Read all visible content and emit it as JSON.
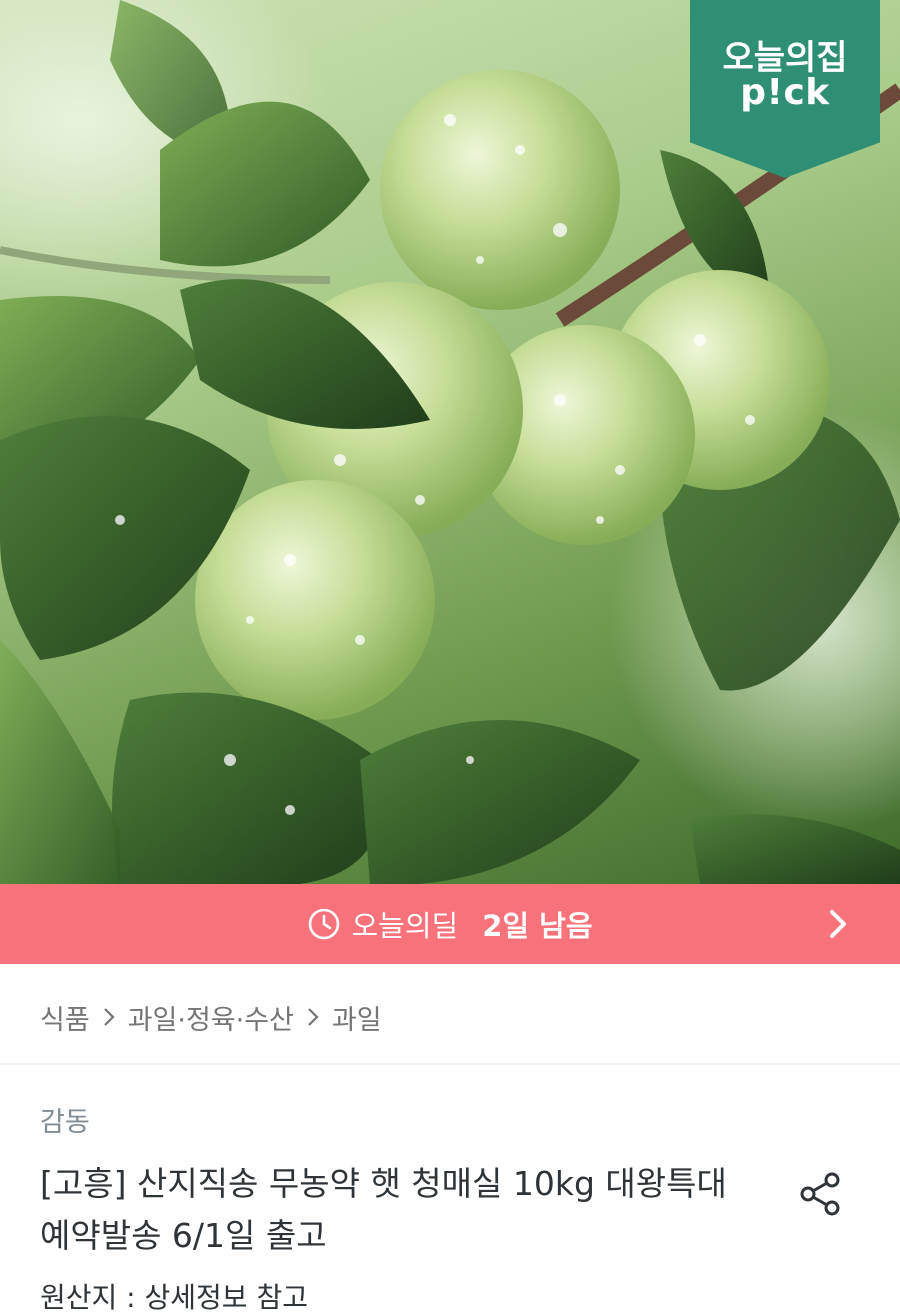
{
  "badge": {
    "line1": "오늘의집",
    "line2": "p!ck"
  },
  "deal": {
    "label": "오늘의딜",
    "remaining": "2일 남음"
  },
  "breadcrumb": [
    "식품",
    "과일·정육·수산",
    "과일"
  ],
  "product": {
    "brand": "감동",
    "title": "[고흥] 산지직송 무농약 햇 청매실 10kg 대왕특대 예약발송 6/1일 출고",
    "origin": "원산지 : 상세정보 참고"
  },
  "colors": {
    "deal_bar": "#f7727a",
    "badge": "#2f8f74",
    "text": "#2f3438",
    "muted": "#828c94"
  },
  "icons": {
    "deal": "clock-icon",
    "deal_nav": "chevron-right-icon",
    "share": "share-icon",
    "crumb_sep": "chevron-right-icon"
  }
}
